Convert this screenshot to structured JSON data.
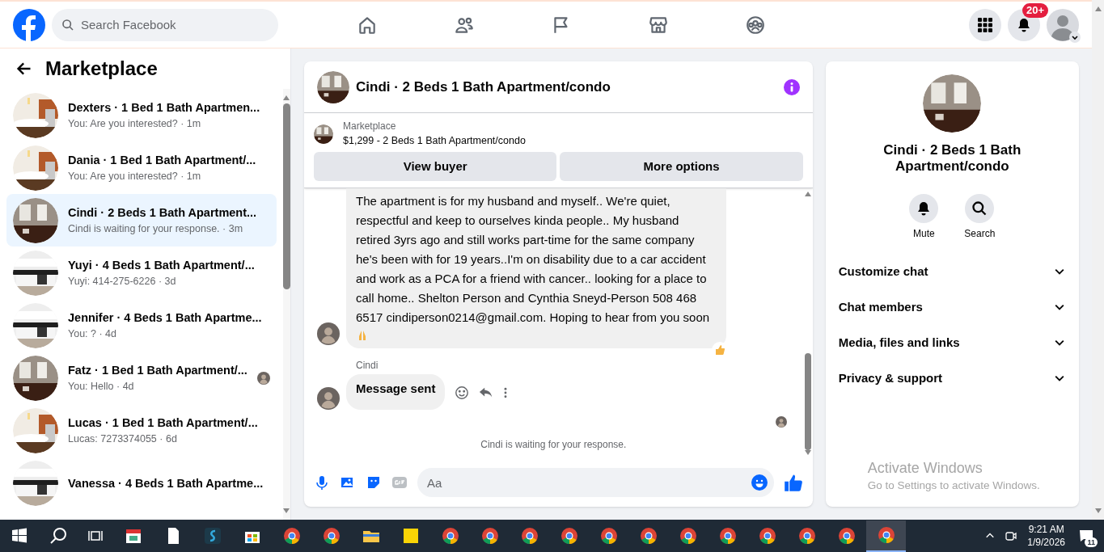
{
  "top_bar": {
    "search": {
      "placeholder": "Search Facebook"
    },
    "nav": [
      {
        "kind": "home",
        "selected": false
      },
      {
        "kind": "friends",
        "selected": false
      },
      {
        "kind": "pages",
        "selected": false
      },
      {
        "kind": "marketplace",
        "selected": false
      },
      {
        "kind": "groups",
        "selected": false
      }
    ],
    "notifications_badge": "20+"
  },
  "sidebar": {
    "title": "Marketplace",
    "conversations": [
      {
        "name": "Dexters · 1 Bed 1 Bath Apartmen...",
        "preview": "You: Are you interested? · 1m",
        "selected": false,
        "seen": false
      },
      {
        "name": "Dania · 1 Bed 1 Bath Apartment/...",
        "preview": "You: Are you interested? · 1m",
        "selected": false,
        "seen": false
      },
      {
        "name": "Cindi · 2 Beds 1 Bath Apartment...",
        "preview": "Cindi is waiting for your response. · 3m",
        "selected": true,
        "seen": false
      },
      {
        "name": "Yuyi · 4 Beds 1 Bath Apartment/...",
        "preview": "Yuyi: 414-275-6226 · 3d",
        "selected": false,
        "seen": false
      },
      {
        "name": "Jennifer · 4 Beds 1 Bath Apartme...",
        "preview": "You: ? · 4d",
        "selected": false,
        "seen": false
      },
      {
        "name": "Fatz · 1 Bed 1 Bath Apartment/...",
        "preview": "You: Hello · 4d",
        "selected": false,
        "seen": true
      },
      {
        "name": "Lucas · 1 Bed 1 Bath Apartment/...",
        "preview": "Lucas: 7273374055 · 6d",
        "selected": false,
        "seen": false
      },
      {
        "name": "Vanessa · 4 Beds 1 Bath Apartme...",
        "selected": false,
        "seen": false
      }
    ]
  },
  "chat": {
    "title": "Cindi · 2 Beds 1 Bath Apartment/condo",
    "listing": {
      "label": "Marketplace",
      "text": "$1,299 - 2 Beds 1 Bath Apartment/condo"
    },
    "buttons": [
      "View buyer",
      "More options"
    ],
    "messages": [
      {
        "text": "The apartment is for my husband and myself..  We're quiet, respectful and keep to ourselves kinda people..  My husband retired 3yrs ago and still works part-time for the same company he's been with for 19 years..I'm on disability due to a car accident and work as a PCA for a friend with cancer..  looking for a place to call home..  Shelton Person and Cynthia Sneyd-Person 508 468 6517 cindiperson0214@gmail.com. Hoping to hear from you soon",
        "reacted": true
      },
      {
        "sender": "Cindi",
        "text": "Message sent",
        "reacted": false
      }
    ],
    "status": "Cindi is waiting for your response.",
    "composer": {
      "placeholder": "Aa"
    }
  },
  "details": {
    "title": "Cindi · 2 Beds 1 Bath Apartment/condo",
    "actions": [
      {
        "kind": "mute",
        "label": "Mute"
      },
      {
        "kind": "search",
        "label": "Search"
      }
    ],
    "sections": [
      {
        "label": "Customize chat",
        "expanded": false
      },
      {
        "label": "Chat members",
        "expanded": false
      },
      {
        "label": "Media, files and links",
        "expanded": false
      },
      {
        "label": "Privacy & support",
        "expanded": false
      }
    ]
  },
  "activation_notice": {
    "title": "Activate Windows",
    "text": "Go to Settings to activate Windows."
  },
  "taskbar": {
    "apps": [
      {
        "kind": "calendar",
        "selected": false
      },
      {
        "kind": "file",
        "selected": false
      },
      {
        "kind": "s-app",
        "selected": false
      },
      {
        "kind": "store",
        "selected": false
      },
      {
        "kind": "chrome",
        "selected": false
      },
      {
        "kind": "chrome",
        "selected": false
      },
      {
        "kind": "folder",
        "selected": false
      },
      {
        "kind": "notes",
        "selected": false
      },
      {
        "kind": "chrome",
        "selected": false
      },
      {
        "kind": "chrome",
        "selected": false
      },
      {
        "kind": "chrome",
        "selected": false
      },
      {
        "kind": "chrome",
        "selected": false
      },
      {
        "kind": "chrome",
        "selected": false
      },
      {
        "kind": "chrome",
        "selected": false
      },
      {
        "kind": "chrome",
        "selected": false
      },
      {
        "kind": "chrome",
        "selected": false
      },
      {
        "kind": "chrome",
        "selected": false
      },
      {
        "kind": "chrome",
        "selected": false
      },
      {
        "kind": "chrome",
        "selected": false
      },
      {
        "kind": "chrome",
        "selected": true
      }
    ],
    "time": "9:21 AM",
    "date": "1/9/2026",
    "notification_count": "11"
  }
}
